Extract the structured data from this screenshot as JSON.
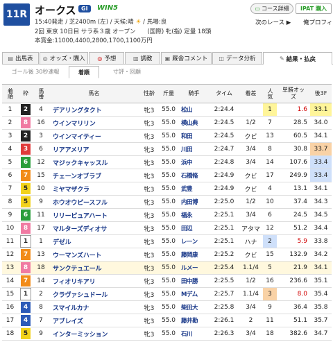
{
  "header": {
    "race_no": "11R",
    "race_name": "オークス",
    "grade": "GI",
    "win5": "WIN5",
    "info_line1": "15:40発走 / 芝2400m (左) / 天候:晴",
    "track_cond": "/ 馬場:良",
    "info_line2": "2回 東京 10日目 サラ系３歳 オープン　　(国際) 牝(指) 定量 18頭",
    "info_line3": "本賞金:11000,4400,2800,1700,1100万円",
    "course_btn": "コース詳細",
    "ipat_btn": "IPAT 購入",
    "next": "次のレース ▶",
    "prev": "俺プロフィ"
  },
  "tabs": [
    {
      "icon": "list-icon",
      "glyph": "▤",
      "label": "出馬表"
    },
    {
      "icon": "coin-icon",
      "glyph": "◎",
      "label": "オッズ・購入"
    },
    {
      "icon": "target-icon",
      "glyph": "◎",
      "label": "予想"
    },
    {
      "icon": "chart-icon",
      "glyph": "▥",
      "label": "調教"
    },
    {
      "icon": "comment-icon",
      "glyph": "▣",
      "label": "厩舎コメント"
    },
    {
      "icon": "analysis-icon",
      "glyph": "◫",
      "label": "データ分析"
    },
    {
      "icon": "result-icon",
      "glyph": "✎",
      "label": "結果・払戻"
    }
  ],
  "subtabs": [
    "ゴール後 30秒速報",
    "着順",
    "寸評・回顧"
  ],
  "columns": [
    "着順",
    "枠",
    "馬番",
    "馬名",
    "性齢",
    "斤量",
    "騎手",
    "タイム",
    "着差",
    "人気",
    "単勝オッズ",
    "後3F"
  ],
  "rows": [
    {
      "rank": "1",
      "waku": "2",
      "num": "4",
      "name": "デアリングタクト",
      "sex": "牝3",
      "wt": "55.0",
      "jockey": "松山",
      "time": "2:24.4",
      "margin": "",
      "pop": "1",
      "odds": "1.6",
      "l3f": "33.1"
    },
    {
      "rank": "2",
      "waku": "8",
      "num": "16",
      "name": "ウインマリリン",
      "sex": "牝3",
      "wt": "55.0",
      "jockey": "横山典",
      "time": "2:24.5",
      "margin": "1/2",
      "pop": "7",
      "odds": "28.5",
      "l3f": "34.0"
    },
    {
      "rank": "3",
      "waku": "2",
      "num": "3",
      "name": "ウインマイティー",
      "sex": "牝3",
      "wt": "55.0",
      "jockey": "和田",
      "time": "2:24.5",
      "margin": "クビ",
      "pop": "13",
      "odds": "60.5",
      "l3f": "34.1"
    },
    {
      "rank": "4",
      "waku": "3",
      "num": "6",
      "name": "リアアメリア",
      "sex": "牝3",
      "wt": "55.0",
      "jockey": "川田",
      "time": "2:24.7",
      "margin": "3/4",
      "pop": "8",
      "odds": "30.8",
      "l3f": "33.7"
    },
    {
      "rank": "5",
      "waku": "6",
      "num": "12",
      "name": "マジックキャッスル",
      "sex": "牝3",
      "wt": "55.0",
      "jockey": "浜中",
      "time": "2:24.8",
      "margin": "3/4",
      "pop": "14",
      "odds": "107.6",
      "l3f": "33.4"
    },
    {
      "rank": "6",
      "waku": "7",
      "num": "15",
      "name": "チェーンオブラブ",
      "sex": "牝3",
      "wt": "55.0",
      "jockey": "石橋脩",
      "time": "2:24.9",
      "margin": "クビ",
      "pop": "17",
      "odds": "249.9",
      "l3f": "33.4"
    },
    {
      "rank": "7",
      "waku": "5",
      "num": "10",
      "name": "ミヤマザクラ",
      "sex": "牝3",
      "wt": "55.0",
      "jockey": "武豊",
      "time": "2:24.9",
      "margin": "クビ",
      "pop": "4",
      "odds": "13.1",
      "l3f": "34.1"
    },
    {
      "rank": "8",
      "waku": "5",
      "num": "9",
      "name": "ホウオウピースフル",
      "sex": "牝3",
      "wt": "55.0",
      "jockey": "内田博",
      "time": "2:25.0",
      "margin": "1/2",
      "pop": "10",
      "odds": "37.4",
      "l3f": "34.3"
    },
    {
      "rank": "9",
      "waku": "6",
      "num": "11",
      "name": "リリーピュアハート",
      "sex": "牝3",
      "wt": "55.0",
      "jockey": "福永",
      "time": "2:25.1",
      "margin": "3/4",
      "pop": "6",
      "odds": "24.5",
      "l3f": "34.5"
    },
    {
      "rank": "10",
      "waku": "8",
      "num": "17",
      "name": "マルターズディオサ",
      "sex": "牝3",
      "wt": "55.0",
      "jockey": "田辺",
      "time": "2:25.1",
      "margin": "アタマ",
      "pop": "12",
      "odds": "51.2",
      "l3f": "34.4"
    },
    {
      "rank": "11",
      "waku": "1",
      "num": "1",
      "name": "デゼル",
      "sex": "牝3",
      "wt": "55.0",
      "jockey": "レーン",
      "time": "2:25.1",
      "margin": "ハナ",
      "pop": "2",
      "odds": "5.9",
      "l3f": "33.8"
    },
    {
      "rank": "12",
      "waku": "7",
      "num": "13",
      "name": "ウーマンズハート",
      "sex": "牝3",
      "wt": "55.0",
      "jockey": "藤岡康",
      "time": "2:25.2",
      "margin": "クビ",
      "pop": "15",
      "odds": "132.9",
      "l3f": "34.2"
    },
    {
      "rank": "13",
      "waku": "8",
      "num": "18",
      "name": "サンクテュエール",
      "sex": "牝3",
      "wt": "55.0",
      "jockey": "ルメー",
      "time": "2:25.4",
      "margin": "1.1/4",
      "pop": "5",
      "odds": "21.9",
      "l3f": "34.1"
    },
    {
      "rank": "14",
      "waku": "7",
      "num": "14",
      "name": "フィオリキアリ",
      "sex": "牝3",
      "wt": "55.0",
      "jockey": "田中勝",
      "time": "2:25.5",
      "margin": "1/2",
      "pop": "16",
      "odds": "236.6",
      "l3f": "35.1"
    },
    {
      "rank": "15",
      "waku": "1",
      "num": "2",
      "name": "クラヴァシュドール",
      "sex": "牝3",
      "wt": "55.0",
      "jockey": "Mデム",
      "time": "2:25.7",
      "margin": "1.1/4",
      "pop": "3",
      "odds": "8.0",
      "l3f": "35.4"
    },
    {
      "rank": "16",
      "waku": "4",
      "num": "8",
      "name": "スマイルカナ",
      "sex": "牝3",
      "wt": "55.0",
      "jockey": "柴田大",
      "time": "2:25.8",
      "margin": "3/4",
      "pop": "9",
      "odds": "36.4",
      "l3f": "35.8"
    },
    {
      "rank": "17",
      "waku": "4",
      "num": "7",
      "name": "アブレイズ",
      "sex": "牝3",
      "wt": "55.0",
      "jockey": "藤井勘",
      "time": "2:26.1",
      "margin": "2",
      "pop": "11",
      "odds": "51.1",
      "l3f": "35.7"
    },
    {
      "rank": "18",
      "waku": "5",
      "num": "9",
      "name": "インターミッション",
      "sex": "牝3",
      "wt": "55.0",
      "jockey": "石川",
      "time": "2:26.3",
      "margin": "3/4",
      "pop": "18",
      "odds": "382.6",
      "l3f": "34.7"
    }
  ],
  "waku_colors": {
    "1": {
      "bg": "#ffffff",
      "fg": "#222222"
    },
    "2": {
      "bg": "#222222",
      "fg": "#ffffff"
    },
    "3": {
      "bg": "#e03a3a",
      "fg": "#ffffff"
    },
    "4": {
      "bg": "#2c5ab8",
      "fg": "#ffffff"
    },
    "5": {
      "bg": "#f2d21a",
      "fg": "#222222"
    },
    "6": {
      "bg": "#2a9d3a",
      "fg": "#ffffff"
    },
    "7": {
      "bg": "#f28c1a",
      "fg": "#ffffff"
    },
    "8": {
      "bg": "#f07aa2",
      "fg": "#ffffff"
    }
  },
  "highlight_row_rank": "13"
}
